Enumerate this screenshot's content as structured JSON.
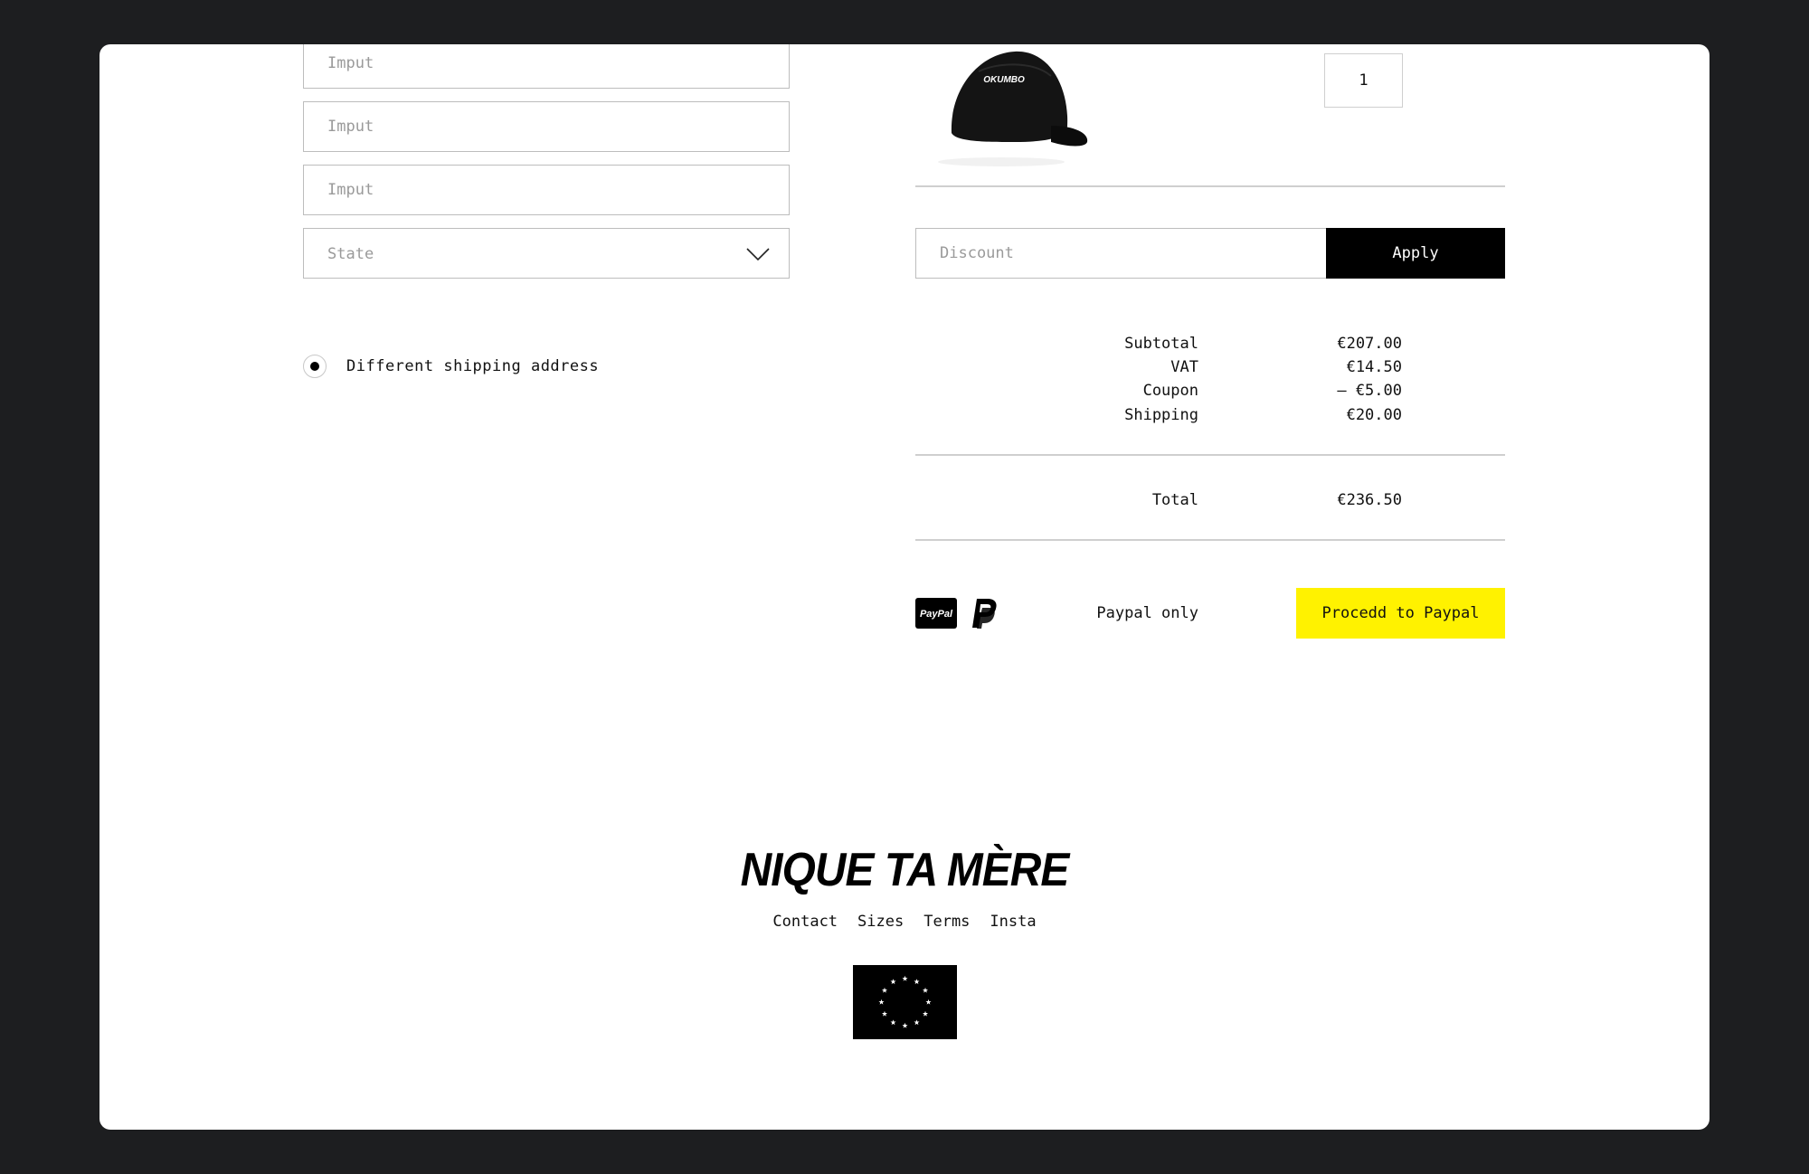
{
  "form": {
    "inputs": [
      {
        "placeholder": "Imput"
      },
      {
        "placeholder": "Imput"
      },
      {
        "placeholder": "Imput"
      }
    ],
    "state_select": {
      "label": "State"
    },
    "shipping_option": {
      "label": "Different shipping address",
      "selected": true
    }
  },
  "cart": {
    "product": {
      "brand_text": "OKUMBO"
    },
    "quantity": "1",
    "discount": {
      "placeholder": "Discount",
      "apply_label": "Apply"
    },
    "summary": [
      {
        "label": "Subtotal",
        "value": "€207.00"
      },
      {
        "label": "VAT",
        "value": "€14.50"
      },
      {
        "label": "Coupon",
        "value": "– €5.00"
      },
      {
        "label": "Shipping",
        "value": "€20.00"
      }
    ],
    "total": {
      "label": "Total",
      "value": "€236.50"
    },
    "payment": {
      "badge_text": "PayPal",
      "note": "Paypal only",
      "proceed_label": "Procedd to Paypal"
    }
  },
  "footer": {
    "brand": "NIQUE TA MÈRE",
    "links": [
      "Contact",
      "Sizes",
      "Terms",
      "Insta"
    ]
  },
  "colors": {
    "background": "#1d1e20",
    "card": "#ffffff",
    "accent_yellow": "#fff200",
    "button_black": "#000000"
  }
}
